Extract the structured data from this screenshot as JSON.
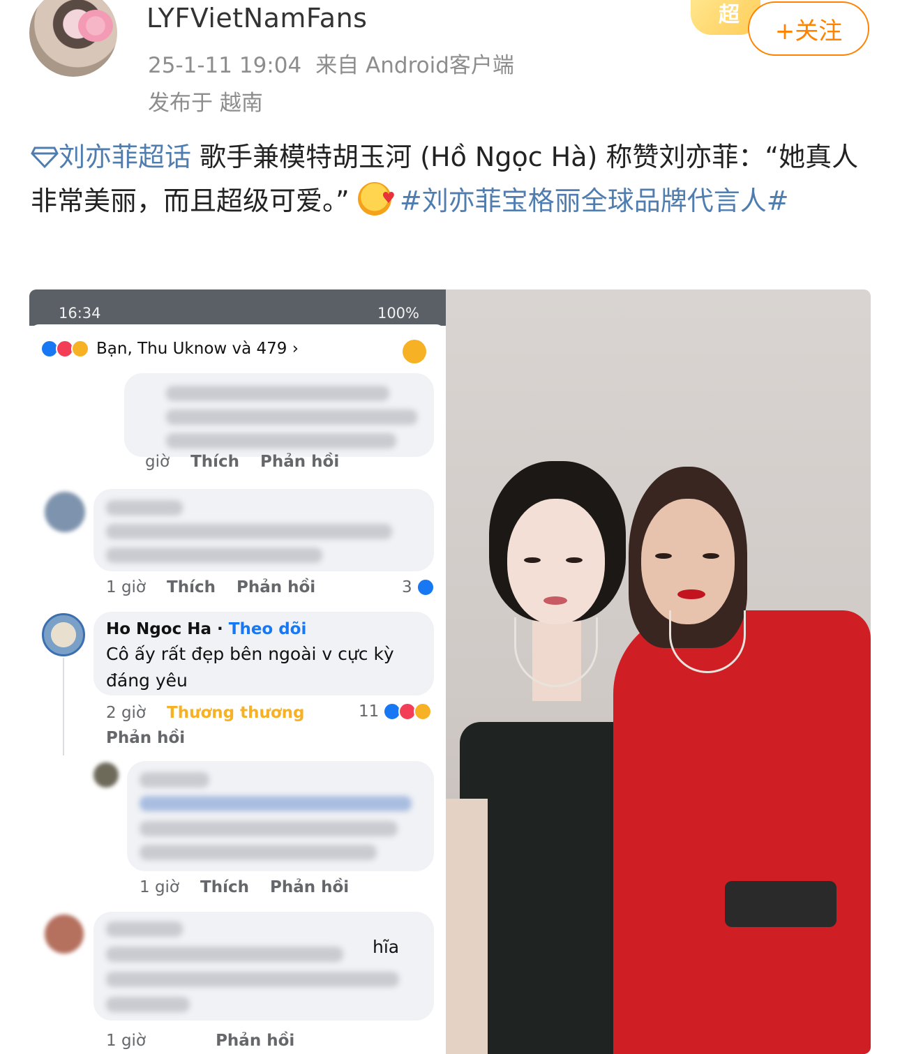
{
  "header": {
    "username": "LYFVietNamFans",
    "datetime": "25-1-11 19:04",
    "source": "来自 Android客户端",
    "location": "发布于 越南",
    "badge": "超",
    "follow_label": "+关注"
  },
  "post": {
    "topic_icon": "diamond-icon",
    "topic": "刘亦菲超话",
    "text_part1": " 歌手兼模特胡玉河 (Hồ Ngọc Hà) 称赞刘亦菲：“她真人非常美丽，而且超级可爱。” ",
    "emoji": "smiling-face-with-hearts",
    "hashtag": "#刘亦菲宝格丽全球品牌代言人#"
  },
  "screenshot": {
    "status_time": "16:34",
    "status_right": "100%",
    "reactions_summary": "Bạn, Thu Uknow và 479",
    "comment1_actions": {
      "time": "giờ",
      "like": "Thích",
      "reply": "Phản hồi"
    },
    "comment2_actions": {
      "time": "1 giờ",
      "like": "Thích",
      "reply": "Phản hồi",
      "count": "3"
    },
    "hnh_comment": {
      "name": "Ho Ngoc Ha",
      "follow": "Theo dõi",
      "text": "Cô ấy rất đẹp bên ngoài v cực kỳ đáng yêu",
      "time": "2 giờ",
      "reaction": "Thương thương",
      "reply": "Phản hồi",
      "count": "11"
    },
    "comment4_actions": {
      "time": "1 giờ",
      "like": "Thích",
      "reply": "Phản hồi"
    },
    "comment5_partial": "hĩa",
    "comment5_actions": {
      "time": "1 giờ",
      "reply": "Phản hồi"
    }
  },
  "colors": {
    "accent_orange": "#ff8200",
    "topic_blue": "#507daf",
    "fb_blue": "#1877f2"
  }
}
